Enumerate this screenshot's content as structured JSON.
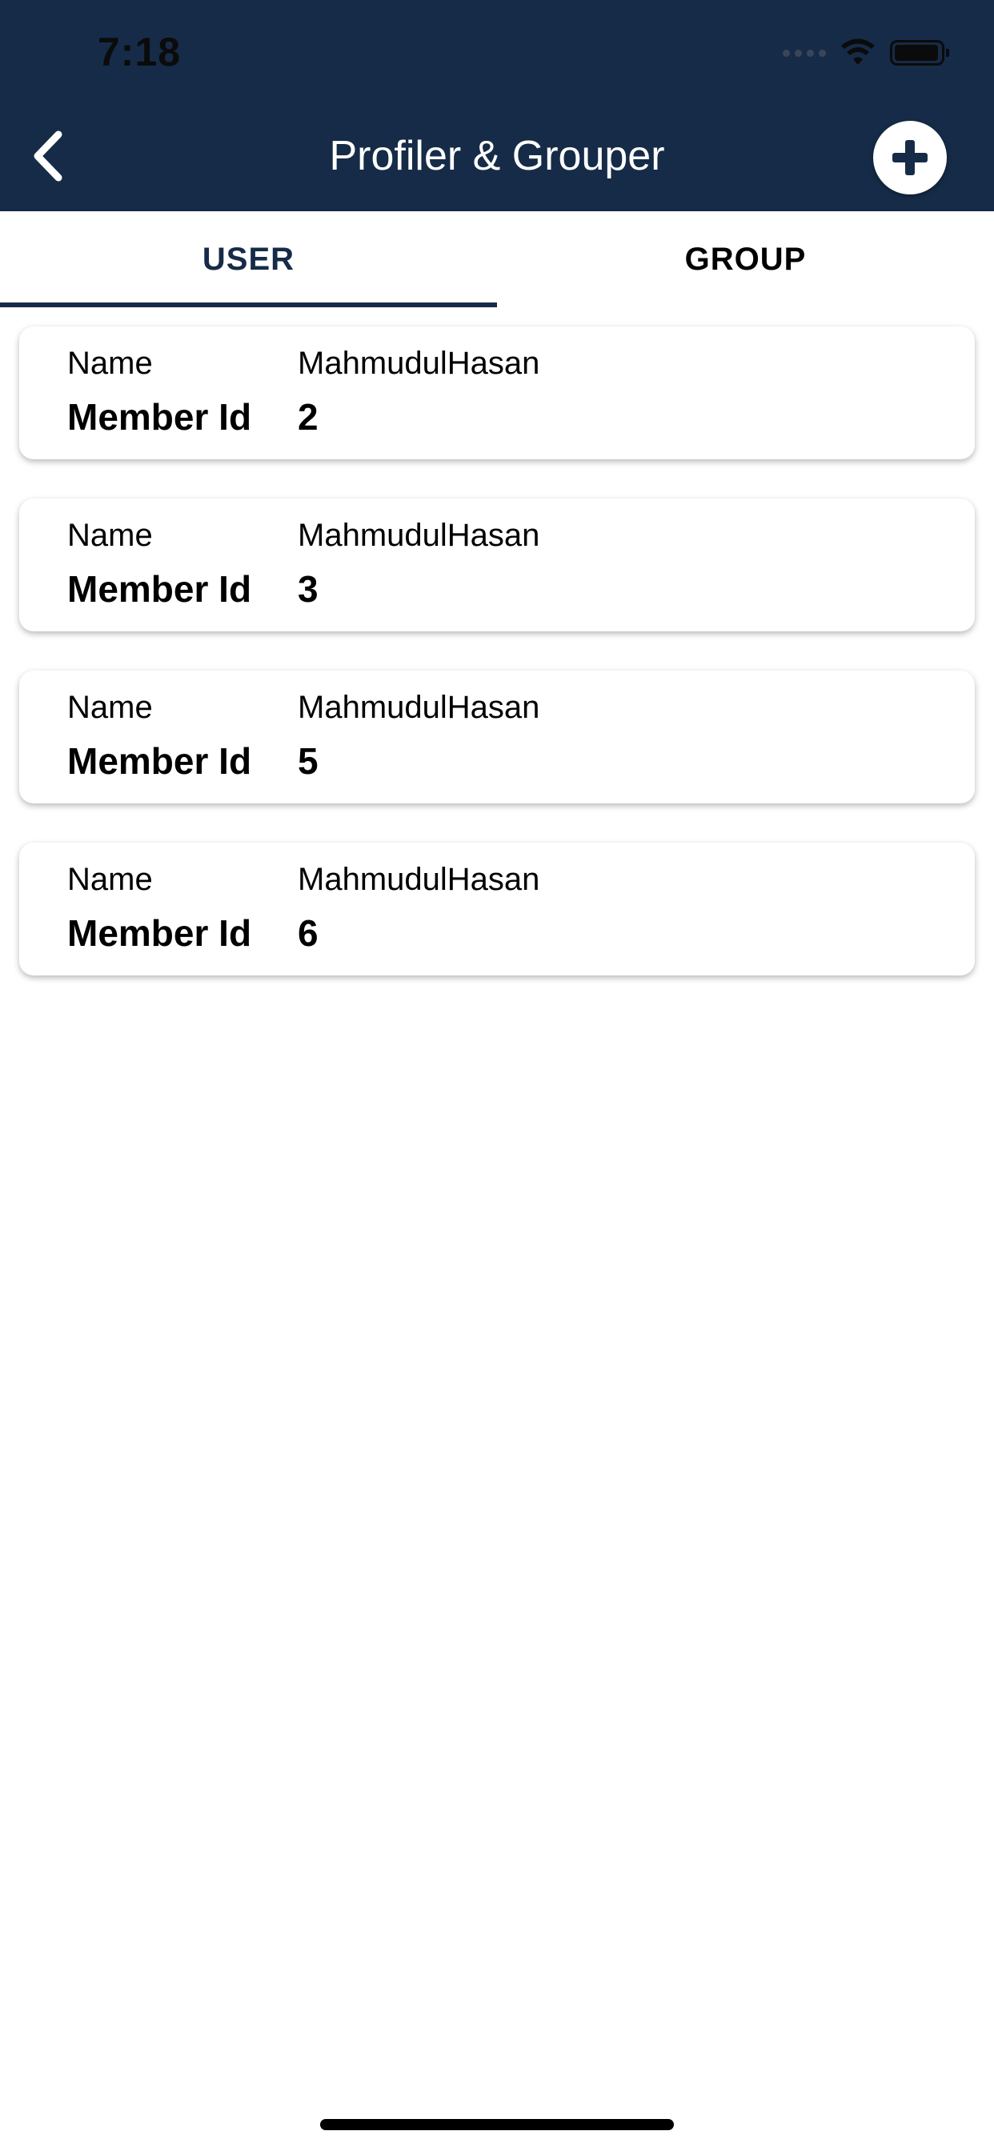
{
  "status_bar": {
    "time": "7:18"
  },
  "header": {
    "title": "Profiler & Grouper",
    "back_icon": "chevron-left-icon",
    "add_icon": "plus-circle-icon",
    "background_color": "#162b47"
  },
  "tabs": [
    {
      "label": "USER",
      "active": true
    },
    {
      "label": "GROUP",
      "active": false
    }
  ],
  "members": [
    {
      "name_label": "Name",
      "name": "MahmudulHasan",
      "id_label": "Member Id",
      "id": "2"
    },
    {
      "name_label": "Name",
      "name": "MahmudulHasan",
      "id_label": "Member Id",
      "id": "3"
    },
    {
      "name_label": "Name",
      "name": "MahmudulHasan",
      "id_label": "Member Id",
      "id": "5"
    },
    {
      "name_label": "Name",
      "name": "MahmudulHasan",
      "id_label": "Member Id",
      "id": "6"
    }
  ]
}
